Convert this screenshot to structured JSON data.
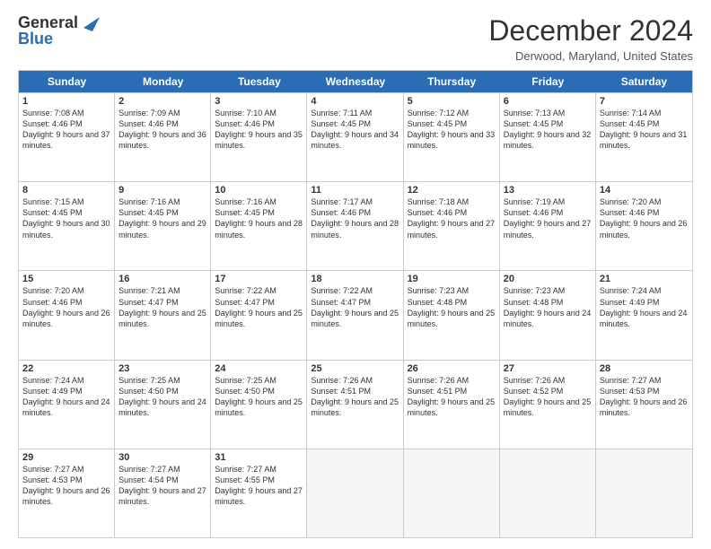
{
  "logo": {
    "line1": "General",
    "line2": "Blue"
  },
  "title": "December 2024",
  "location": "Derwood, Maryland, United States",
  "days_header": [
    "Sunday",
    "Monday",
    "Tuesday",
    "Wednesday",
    "Thursday",
    "Friday",
    "Saturday"
  ],
  "weeks": [
    [
      {
        "day": "1",
        "rise": "Sunrise: 7:08 AM",
        "set": "Sunset: 4:46 PM",
        "light": "Daylight: 9 hours and 37 minutes."
      },
      {
        "day": "2",
        "rise": "Sunrise: 7:09 AM",
        "set": "Sunset: 4:46 PM",
        "light": "Daylight: 9 hours and 36 minutes."
      },
      {
        "day": "3",
        "rise": "Sunrise: 7:10 AM",
        "set": "Sunset: 4:46 PM",
        "light": "Daylight: 9 hours and 35 minutes."
      },
      {
        "day": "4",
        "rise": "Sunrise: 7:11 AM",
        "set": "Sunset: 4:45 PM",
        "light": "Daylight: 9 hours and 34 minutes."
      },
      {
        "day": "5",
        "rise": "Sunrise: 7:12 AM",
        "set": "Sunset: 4:45 PM",
        "light": "Daylight: 9 hours and 33 minutes."
      },
      {
        "day": "6",
        "rise": "Sunrise: 7:13 AM",
        "set": "Sunset: 4:45 PM",
        "light": "Daylight: 9 hours and 32 minutes."
      },
      {
        "day": "7",
        "rise": "Sunrise: 7:14 AM",
        "set": "Sunset: 4:45 PM",
        "light": "Daylight: 9 hours and 31 minutes."
      }
    ],
    [
      {
        "day": "8",
        "rise": "Sunrise: 7:15 AM",
        "set": "Sunset: 4:45 PM",
        "light": "Daylight: 9 hours and 30 minutes."
      },
      {
        "day": "9",
        "rise": "Sunrise: 7:16 AM",
        "set": "Sunset: 4:45 PM",
        "light": "Daylight: 9 hours and 29 minutes."
      },
      {
        "day": "10",
        "rise": "Sunrise: 7:16 AM",
        "set": "Sunset: 4:45 PM",
        "light": "Daylight: 9 hours and 28 minutes."
      },
      {
        "day": "11",
        "rise": "Sunrise: 7:17 AM",
        "set": "Sunset: 4:46 PM",
        "light": "Daylight: 9 hours and 28 minutes."
      },
      {
        "day": "12",
        "rise": "Sunrise: 7:18 AM",
        "set": "Sunset: 4:46 PM",
        "light": "Daylight: 9 hours and 27 minutes."
      },
      {
        "day": "13",
        "rise": "Sunrise: 7:19 AM",
        "set": "Sunset: 4:46 PM",
        "light": "Daylight: 9 hours and 27 minutes."
      },
      {
        "day": "14",
        "rise": "Sunrise: 7:20 AM",
        "set": "Sunset: 4:46 PM",
        "light": "Daylight: 9 hours and 26 minutes."
      }
    ],
    [
      {
        "day": "15",
        "rise": "Sunrise: 7:20 AM",
        "set": "Sunset: 4:46 PM",
        "light": "Daylight: 9 hours and 26 minutes."
      },
      {
        "day": "16",
        "rise": "Sunrise: 7:21 AM",
        "set": "Sunset: 4:47 PM",
        "light": "Daylight: 9 hours and 25 minutes."
      },
      {
        "day": "17",
        "rise": "Sunrise: 7:22 AM",
        "set": "Sunset: 4:47 PM",
        "light": "Daylight: 9 hours and 25 minutes."
      },
      {
        "day": "18",
        "rise": "Sunrise: 7:22 AM",
        "set": "Sunset: 4:47 PM",
        "light": "Daylight: 9 hours and 25 minutes."
      },
      {
        "day": "19",
        "rise": "Sunrise: 7:23 AM",
        "set": "Sunset: 4:48 PM",
        "light": "Daylight: 9 hours and 25 minutes."
      },
      {
        "day": "20",
        "rise": "Sunrise: 7:23 AM",
        "set": "Sunset: 4:48 PM",
        "light": "Daylight: 9 hours and 24 minutes."
      },
      {
        "day": "21",
        "rise": "Sunrise: 7:24 AM",
        "set": "Sunset: 4:49 PM",
        "light": "Daylight: 9 hours and 24 minutes."
      }
    ],
    [
      {
        "day": "22",
        "rise": "Sunrise: 7:24 AM",
        "set": "Sunset: 4:49 PM",
        "light": "Daylight: 9 hours and 24 minutes."
      },
      {
        "day": "23",
        "rise": "Sunrise: 7:25 AM",
        "set": "Sunset: 4:50 PM",
        "light": "Daylight: 9 hours and 24 minutes."
      },
      {
        "day": "24",
        "rise": "Sunrise: 7:25 AM",
        "set": "Sunset: 4:50 PM",
        "light": "Daylight: 9 hours and 25 minutes."
      },
      {
        "day": "25",
        "rise": "Sunrise: 7:26 AM",
        "set": "Sunset: 4:51 PM",
        "light": "Daylight: 9 hours and 25 minutes."
      },
      {
        "day": "26",
        "rise": "Sunrise: 7:26 AM",
        "set": "Sunset: 4:51 PM",
        "light": "Daylight: 9 hours and 25 minutes."
      },
      {
        "day": "27",
        "rise": "Sunrise: 7:26 AM",
        "set": "Sunset: 4:52 PM",
        "light": "Daylight: 9 hours and 25 minutes."
      },
      {
        "day": "28",
        "rise": "Sunrise: 7:27 AM",
        "set": "Sunset: 4:53 PM",
        "light": "Daylight: 9 hours and 26 minutes."
      }
    ],
    [
      {
        "day": "29",
        "rise": "Sunrise: 7:27 AM",
        "set": "Sunset: 4:53 PM",
        "light": "Daylight: 9 hours and 26 minutes."
      },
      {
        "day": "30",
        "rise": "Sunrise: 7:27 AM",
        "set": "Sunset: 4:54 PM",
        "light": "Daylight: 9 hours and 27 minutes."
      },
      {
        "day": "31",
        "rise": "Sunrise: 7:27 AM",
        "set": "Sunset: 4:55 PM",
        "light": "Daylight: 9 hours and 27 minutes."
      },
      null,
      null,
      null,
      null
    ]
  ]
}
